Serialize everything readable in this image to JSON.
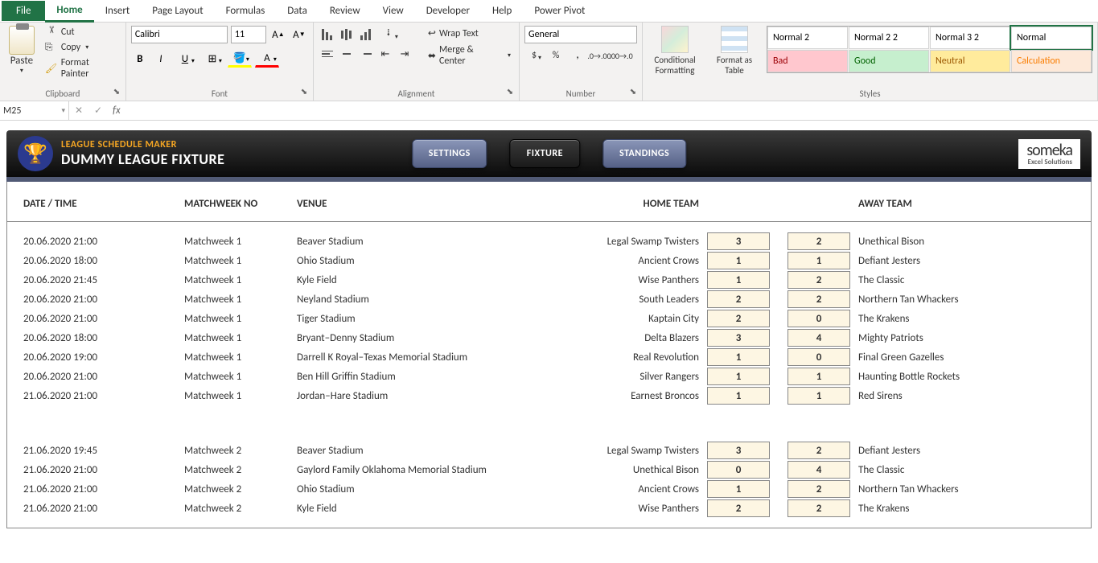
{
  "ribbon": {
    "tabs": [
      "File",
      "Home",
      "Insert",
      "Page Layout",
      "Formulas",
      "Data",
      "Review",
      "View",
      "Developer",
      "Help",
      "Power Pivot"
    ],
    "active_tab": "Home",
    "clipboard": {
      "paste": "Paste",
      "cut": "Cut",
      "copy": "Copy",
      "format_painter": "Format Painter",
      "label": "Clipboard"
    },
    "font": {
      "name": "Calibri",
      "size": "11",
      "label": "Font"
    },
    "alignment": {
      "wrap": "Wrap Text",
      "merge": "Merge & Center",
      "label": "Alignment"
    },
    "number": {
      "format": "General",
      "label": "Number"
    },
    "styles": {
      "cond": "Conditional Formatting",
      "table": "Format as Table",
      "label": "Styles",
      "cells": [
        {
          "t": "Normal 2",
          "bg": "#ffffff",
          "c": "#000"
        },
        {
          "t": "Normal 2 2",
          "bg": "#ffffff",
          "c": "#000"
        },
        {
          "t": "Normal 3 2",
          "bg": "#ffffff",
          "c": "#000"
        },
        {
          "t": "Normal",
          "bg": "#ffffff",
          "c": "#000"
        },
        {
          "t": "Bad",
          "bg": "#ffc7ce",
          "c": "#9c0006"
        },
        {
          "t": "Good",
          "bg": "#c6efce",
          "c": "#006100"
        },
        {
          "t": "Neutral",
          "bg": "#ffeb9c",
          "c": "#9c5700"
        },
        {
          "t": "Calculation",
          "bg": "#fde9d9",
          "c": "#fa7d00"
        }
      ]
    }
  },
  "formula_bar": {
    "name_box": "M25",
    "fx": "fx"
  },
  "app": {
    "subtitle": "LEAGUE SCHEDULE MAKER",
    "title": "DUMMY LEAGUE FIXTURE",
    "nav": {
      "settings": "SETTINGS",
      "fixture": "FIXTURE",
      "standings": "STANDINGS"
    },
    "logo": {
      "brand": "someka",
      "tag": "Excel Solutions"
    },
    "columns": {
      "date": "DATE / TIME",
      "mw": "MATCHWEEK NO",
      "venue": "VENUE",
      "home": "HOME TEAM",
      "away": "AWAY TEAM"
    },
    "fixtures_week1": [
      {
        "dt": "20.06.2020 21:00",
        "mw": "Matchweek 1",
        "venue": "Beaver Stadium",
        "home": "Legal Swamp Twisters",
        "hs": "3",
        "as": "2",
        "away": "Unethical Bison"
      },
      {
        "dt": "20.06.2020 18:00",
        "mw": "Matchweek 1",
        "venue": "Ohio Stadium",
        "home": "Ancient Crows",
        "hs": "1",
        "as": "1",
        "away": "Defiant Jesters"
      },
      {
        "dt": "20.06.2020 21:45",
        "mw": "Matchweek 1",
        "venue": "Kyle Field",
        "home": "Wise Panthers",
        "hs": "1",
        "as": "2",
        "away": "The Classic"
      },
      {
        "dt": "20.06.2020 21:00",
        "mw": "Matchweek 1",
        "venue": "Neyland Stadium",
        "home": "South Leaders",
        "hs": "2",
        "as": "2",
        "away": "Northern Tan Whackers"
      },
      {
        "dt": "20.06.2020 21:00",
        "mw": "Matchweek 1",
        "venue": "Tiger Stadium",
        "home": "Kaptain City",
        "hs": "2",
        "as": "0",
        "away": "The Krakens"
      },
      {
        "dt": "20.06.2020 18:00",
        "mw": "Matchweek 1",
        "venue": "Bryant–Denny Stadium",
        "home": "Delta Blazers",
        "hs": "3",
        "as": "4",
        "away": "Mighty Patriots"
      },
      {
        "dt": "20.06.2020 19:00",
        "mw": "Matchweek 1",
        "venue": "Darrell K Royal–Texas Memorial Stadium",
        "home": "Real Revolution",
        "hs": "1",
        "as": "0",
        "away": "Final Green Gazelles"
      },
      {
        "dt": "20.06.2020 21:00",
        "mw": "Matchweek 1",
        "venue": "Ben Hill Griffin Stadium",
        "home": "Silver Rangers",
        "hs": "1",
        "as": "1",
        "away": "Haunting Bottle Rockets"
      },
      {
        "dt": "21.06.2020 21:00",
        "mw": "Matchweek 1",
        "venue": "Jordan–Hare Stadium",
        "home": "Earnest Broncos",
        "hs": "1",
        "as": "1",
        "away": "Red Sirens"
      }
    ],
    "fixtures_week2": [
      {
        "dt": "21.06.2020 19:45",
        "mw": "Matchweek 2",
        "venue": "Beaver Stadium",
        "home": "Legal Swamp Twisters",
        "hs": "3",
        "as": "2",
        "away": "Defiant Jesters"
      },
      {
        "dt": "21.06.2020 21:00",
        "mw": "Matchweek 2",
        "venue": "Gaylord Family Oklahoma Memorial Stadium",
        "home": "Unethical Bison",
        "hs": "0",
        "as": "4",
        "away": "The Classic"
      },
      {
        "dt": "21.06.2020 21:00",
        "mw": "Matchweek 2",
        "venue": "Ohio Stadium",
        "home": "Ancient Crows",
        "hs": "1",
        "as": "2",
        "away": "Northern Tan Whackers"
      },
      {
        "dt": "21.06.2020 21:00",
        "mw": "Matchweek 2",
        "venue": "Kyle Field",
        "home": "Wise Panthers",
        "hs": "2",
        "as": "2",
        "away": "The Krakens"
      }
    ]
  }
}
